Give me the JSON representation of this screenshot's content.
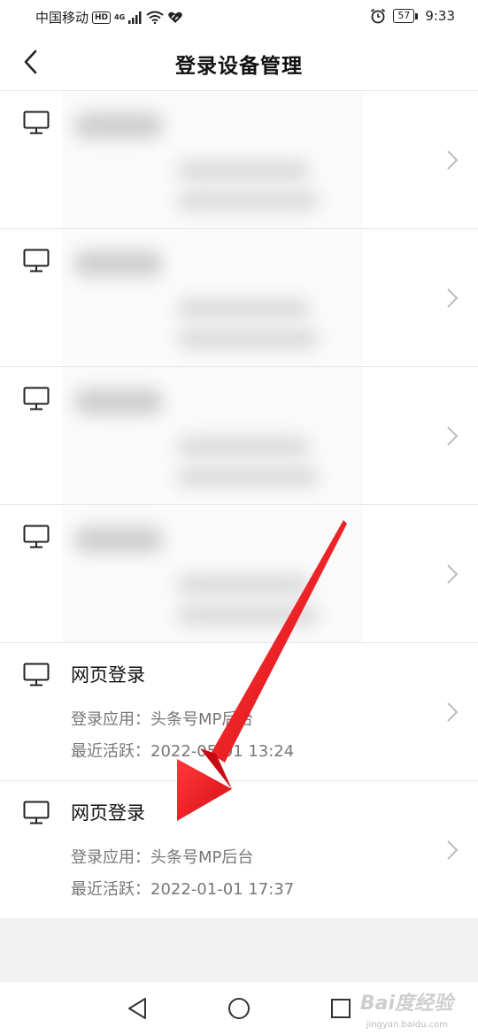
{
  "status_bar": {
    "carrier": "中国移动",
    "hd": "HD",
    "network": "4G",
    "battery": "57",
    "time": "9:33"
  },
  "header": {
    "title": "登录设备管理",
    "back_icon": "chevron-left-icon"
  },
  "devices": [
    {
      "name": "",
      "app": "",
      "active": "",
      "blurred": true
    },
    {
      "name": "",
      "app": "",
      "active": "",
      "blurred": true
    },
    {
      "name": "",
      "app": "",
      "active": "",
      "blurred": true
    },
    {
      "name": "",
      "app": "",
      "active": "",
      "blurred": true
    },
    {
      "name": "网页登录",
      "app": "登录应用：头条号MP后台",
      "active": "最近活跃：2022-05-01 13:24",
      "blurred": false
    },
    {
      "name": "网页登录",
      "app": "登录应用：头条号MP后台",
      "active": "最近活跃：2022-01-01 17:37",
      "blurred": false
    }
  ],
  "system_nav": {
    "back": "triangle-back-icon",
    "home": "circle-home-icon",
    "recent": "square-recent-icon"
  },
  "watermark": {
    "text": "Bai度经验",
    "sub": "jingyan.baidu.com"
  },
  "colors": {
    "annotation_arrow": "#e8131b",
    "secondary_text": "#777777",
    "divider": "#e6e6e6"
  }
}
